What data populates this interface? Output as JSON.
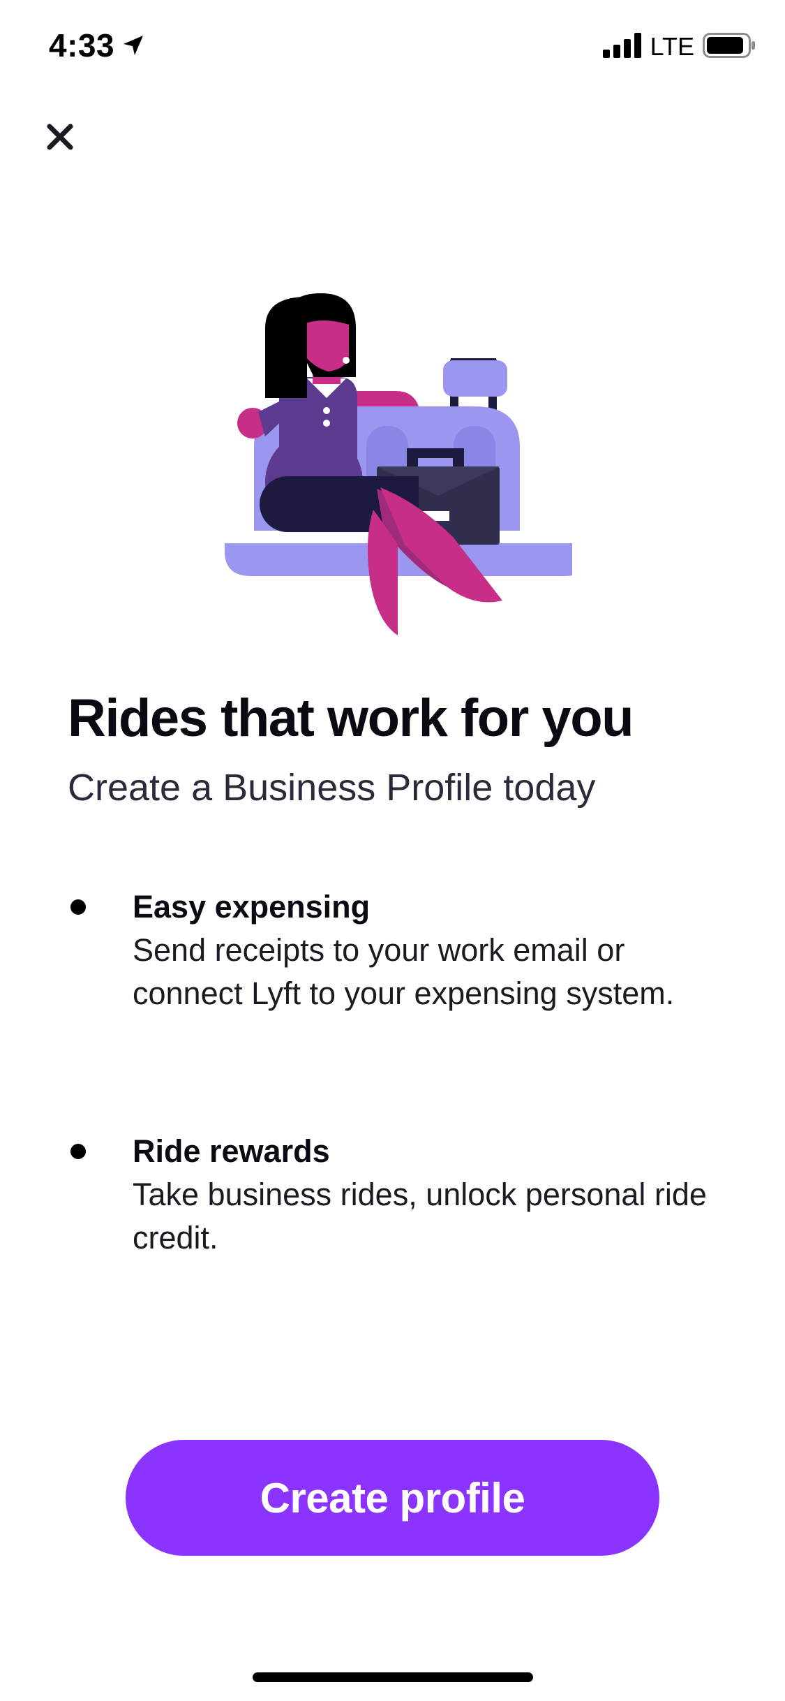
{
  "status_bar": {
    "time": "4:33",
    "network": "LTE",
    "icons": [
      "location-arrow-icon",
      "signal-bars-icon",
      "battery-icon"
    ],
    "signal_bars": 4,
    "battery_level": 0.85
  },
  "header": {
    "close_icon": "close-icon"
  },
  "hero": {
    "illustration": "business-traveler-illustration",
    "title": "Rides that work for you",
    "subtitle": "Create a Business Profile today"
  },
  "features": [
    {
      "title": "Easy expensing",
      "description": "Send receipts to your work email or connect Lyft to your expensing system."
    },
    {
      "title": "Ride rewards",
      "description": "Take business rides, unlock personal ride credit."
    }
  ],
  "cta": {
    "label": "Create profile"
  },
  "colors": {
    "accent": "#8b33ff",
    "illustration_lavender": "#9b97f0",
    "illustration_purple": "#5b3a8f",
    "illustration_magenta": "#c72e87",
    "illustration_navy": "#1d1a3f"
  }
}
